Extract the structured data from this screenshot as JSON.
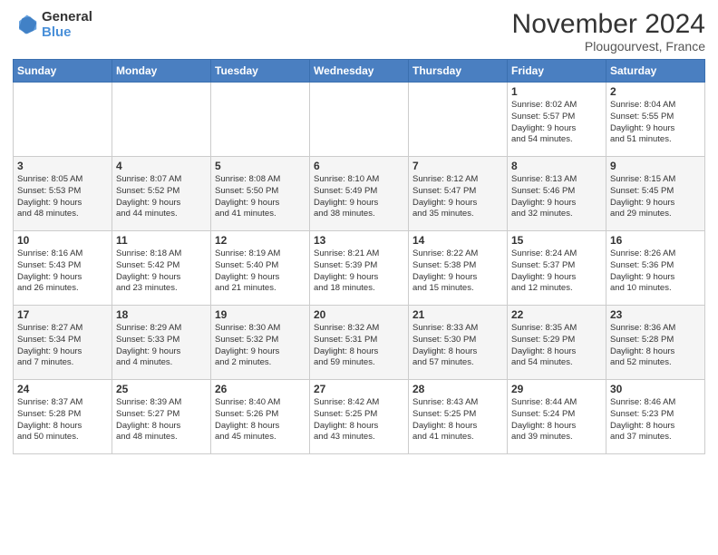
{
  "logo": {
    "line1": "General",
    "line2": "Blue"
  },
  "title": "November 2024",
  "location": "Plougourvest, France",
  "days_header": [
    "Sunday",
    "Monday",
    "Tuesday",
    "Wednesday",
    "Thursday",
    "Friday",
    "Saturday"
  ],
  "weeks": [
    [
      {
        "day": "",
        "info": ""
      },
      {
        "day": "",
        "info": ""
      },
      {
        "day": "",
        "info": ""
      },
      {
        "day": "",
        "info": ""
      },
      {
        "day": "",
        "info": ""
      },
      {
        "day": "1",
        "info": "Sunrise: 8:02 AM\nSunset: 5:57 PM\nDaylight: 9 hours\nand 54 minutes."
      },
      {
        "day": "2",
        "info": "Sunrise: 8:04 AM\nSunset: 5:55 PM\nDaylight: 9 hours\nand 51 minutes."
      }
    ],
    [
      {
        "day": "3",
        "info": "Sunrise: 8:05 AM\nSunset: 5:53 PM\nDaylight: 9 hours\nand 48 minutes."
      },
      {
        "day": "4",
        "info": "Sunrise: 8:07 AM\nSunset: 5:52 PM\nDaylight: 9 hours\nand 44 minutes."
      },
      {
        "day": "5",
        "info": "Sunrise: 8:08 AM\nSunset: 5:50 PM\nDaylight: 9 hours\nand 41 minutes."
      },
      {
        "day": "6",
        "info": "Sunrise: 8:10 AM\nSunset: 5:49 PM\nDaylight: 9 hours\nand 38 minutes."
      },
      {
        "day": "7",
        "info": "Sunrise: 8:12 AM\nSunset: 5:47 PM\nDaylight: 9 hours\nand 35 minutes."
      },
      {
        "day": "8",
        "info": "Sunrise: 8:13 AM\nSunset: 5:46 PM\nDaylight: 9 hours\nand 32 minutes."
      },
      {
        "day": "9",
        "info": "Sunrise: 8:15 AM\nSunset: 5:45 PM\nDaylight: 9 hours\nand 29 minutes."
      }
    ],
    [
      {
        "day": "10",
        "info": "Sunrise: 8:16 AM\nSunset: 5:43 PM\nDaylight: 9 hours\nand 26 minutes."
      },
      {
        "day": "11",
        "info": "Sunrise: 8:18 AM\nSunset: 5:42 PM\nDaylight: 9 hours\nand 23 minutes."
      },
      {
        "day": "12",
        "info": "Sunrise: 8:19 AM\nSunset: 5:40 PM\nDaylight: 9 hours\nand 21 minutes."
      },
      {
        "day": "13",
        "info": "Sunrise: 8:21 AM\nSunset: 5:39 PM\nDaylight: 9 hours\nand 18 minutes."
      },
      {
        "day": "14",
        "info": "Sunrise: 8:22 AM\nSunset: 5:38 PM\nDaylight: 9 hours\nand 15 minutes."
      },
      {
        "day": "15",
        "info": "Sunrise: 8:24 AM\nSunset: 5:37 PM\nDaylight: 9 hours\nand 12 minutes."
      },
      {
        "day": "16",
        "info": "Sunrise: 8:26 AM\nSunset: 5:36 PM\nDaylight: 9 hours\nand 10 minutes."
      }
    ],
    [
      {
        "day": "17",
        "info": "Sunrise: 8:27 AM\nSunset: 5:34 PM\nDaylight: 9 hours\nand 7 minutes."
      },
      {
        "day": "18",
        "info": "Sunrise: 8:29 AM\nSunset: 5:33 PM\nDaylight: 9 hours\nand 4 minutes."
      },
      {
        "day": "19",
        "info": "Sunrise: 8:30 AM\nSunset: 5:32 PM\nDaylight: 9 hours\nand 2 minutes."
      },
      {
        "day": "20",
        "info": "Sunrise: 8:32 AM\nSunset: 5:31 PM\nDaylight: 8 hours\nand 59 minutes."
      },
      {
        "day": "21",
        "info": "Sunrise: 8:33 AM\nSunset: 5:30 PM\nDaylight: 8 hours\nand 57 minutes."
      },
      {
        "day": "22",
        "info": "Sunrise: 8:35 AM\nSunset: 5:29 PM\nDaylight: 8 hours\nand 54 minutes."
      },
      {
        "day": "23",
        "info": "Sunrise: 8:36 AM\nSunset: 5:28 PM\nDaylight: 8 hours\nand 52 minutes."
      }
    ],
    [
      {
        "day": "24",
        "info": "Sunrise: 8:37 AM\nSunset: 5:28 PM\nDaylight: 8 hours\nand 50 minutes."
      },
      {
        "day": "25",
        "info": "Sunrise: 8:39 AM\nSunset: 5:27 PM\nDaylight: 8 hours\nand 48 minutes."
      },
      {
        "day": "26",
        "info": "Sunrise: 8:40 AM\nSunset: 5:26 PM\nDaylight: 8 hours\nand 45 minutes."
      },
      {
        "day": "27",
        "info": "Sunrise: 8:42 AM\nSunset: 5:25 PM\nDaylight: 8 hours\nand 43 minutes."
      },
      {
        "day": "28",
        "info": "Sunrise: 8:43 AM\nSunset: 5:25 PM\nDaylight: 8 hours\nand 41 minutes."
      },
      {
        "day": "29",
        "info": "Sunrise: 8:44 AM\nSunset: 5:24 PM\nDaylight: 8 hours\nand 39 minutes."
      },
      {
        "day": "30",
        "info": "Sunrise: 8:46 AM\nSunset: 5:23 PM\nDaylight: 8 hours\nand 37 minutes."
      }
    ]
  ]
}
